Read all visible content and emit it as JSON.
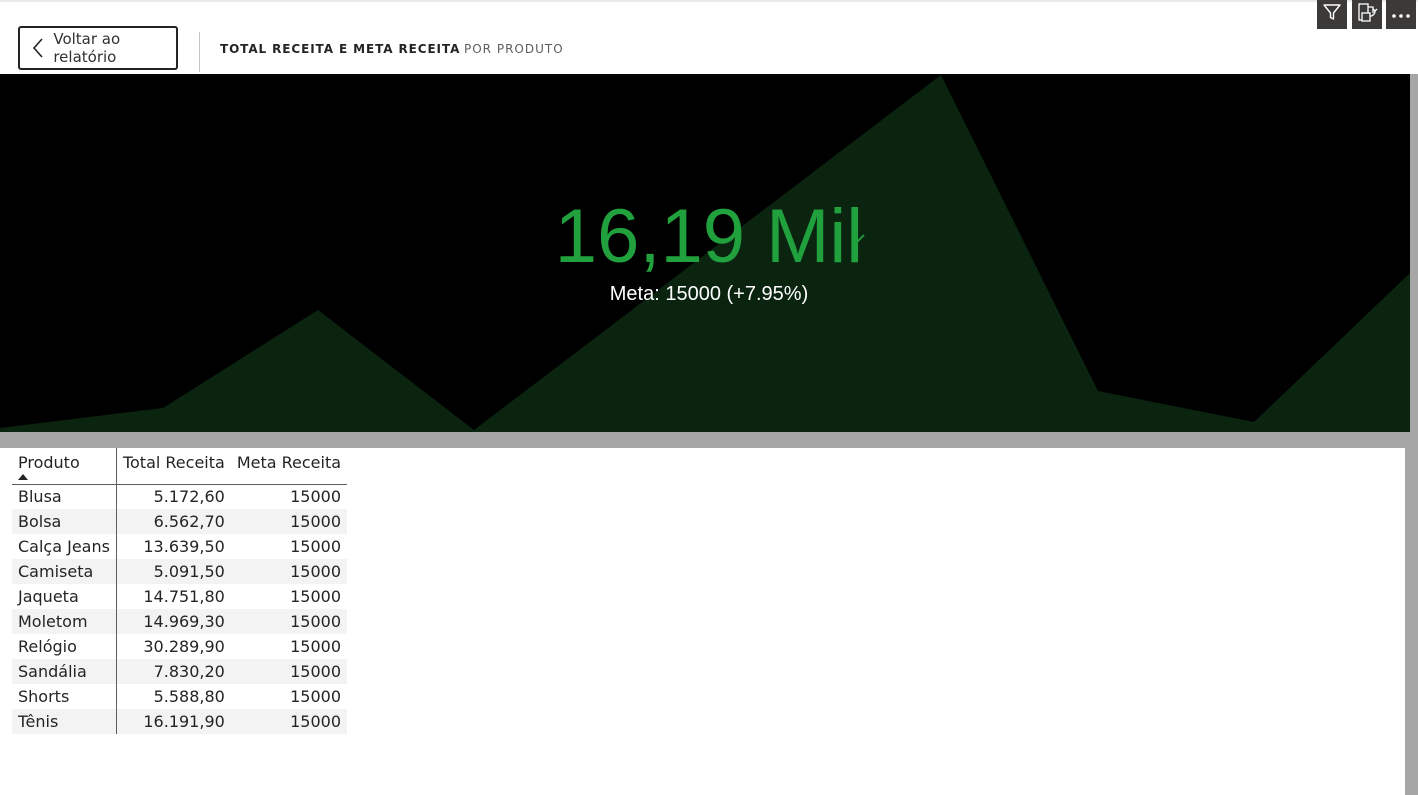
{
  "header": {
    "back_label": "Voltar ao relatório",
    "breadcrumb": [
      "TOTAL RECEITA E META RECEITA",
      "POR PRODUTO"
    ],
    "toolbar_icons": [
      "filter-icon",
      "drill-export-icon",
      "more-options-icon"
    ]
  },
  "kpi": {
    "value": "16,19 Mil",
    "goal_text": "Meta: 15000 (+7.95%)",
    "status": "above-goal",
    "value_color": "#21a13d",
    "trend_color": "#0a2410",
    "background": "#000000"
  },
  "table": {
    "columns": [
      "Produto",
      "Total Receita",
      "Meta Receita"
    ],
    "sort": {
      "column": "Produto",
      "direction": "ascending"
    },
    "rows": [
      [
        "Blusa",
        "5.172,60",
        "15000"
      ],
      [
        "Bolsa",
        "6.562,70",
        "15000"
      ],
      [
        "Calça Jeans",
        "13.639,50",
        "15000"
      ],
      [
        "Camiseta",
        "5.091,50",
        "15000"
      ],
      [
        "Jaqueta",
        "14.751,80",
        "15000"
      ],
      [
        "Moletom",
        "14.969,30",
        "15000"
      ],
      [
        "Relógio",
        "30.289,90",
        "15000"
      ],
      [
        "Sandália",
        "7.830,20",
        "15000"
      ],
      [
        "Shorts",
        "5.588,80",
        "15000"
      ],
      [
        "Tênis",
        "16.191,90",
        "15000"
      ]
    ]
  }
}
